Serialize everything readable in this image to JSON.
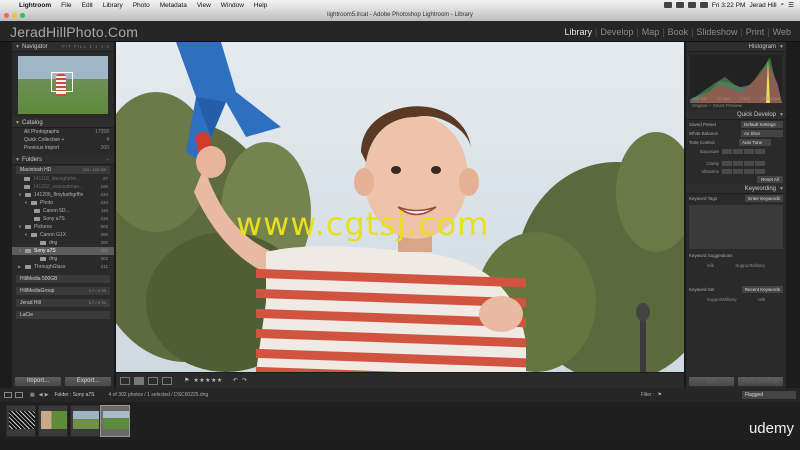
{
  "menubar": {
    "app_name": "Lightroom",
    "items": [
      "File",
      "Edit",
      "Library",
      "Photo",
      "Metadata",
      "View",
      "Window",
      "Help"
    ],
    "clock": "Fri 3:22 PM",
    "user": "Jerad Hill"
  },
  "window": {
    "title": "lightroom5.lrcat - Adobe Photoshop Lightroom - Library"
  },
  "identity_plate": "JeradHillPhoto.Com",
  "modules": [
    "Library",
    "Develop",
    "Map",
    "Book",
    "Slideshow",
    "Print",
    "Web"
  ],
  "active_module": "Library",
  "navigator": {
    "title": "Navigator",
    "zoom_options": "FIT  FILL  1:1  1:3"
  },
  "catalog": {
    "title": "Catalog",
    "rows": [
      {
        "label": "All Photographs",
        "count": "17258"
      },
      {
        "label": "Quick Collection +",
        "count": "4"
      },
      {
        "label": "Previous Import",
        "count": "200"
      }
    ]
  },
  "folders": {
    "title": "Folders",
    "volume": {
      "name": "Macintosh HD",
      "info": "215 / 465 GB"
    },
    "rows": [
      {
        "name": "141118_itavegfathe...",
        "count": "27",
        "dim": true
      },
      {
        "name": "141202_ssassatman...",
        "count": "100",
        "dim": true
      },
      {
        "name": "141206_flmybathgrffin",
        "count": "434"
      },
      {
        "name": "Photo",
        "count": "434"
      },
      {
        "name": "Canon 5D...",
        "count": "116"
      },
      {
        "name": "Sony a7S",
        "count": "318"
      },
      {
        "name": "Pictures",
        "count": "503"
      },
      {
        "name": "Canon G1X",
        "count": "200"
      },
      {
        "name": "dng",
        "count": "200"
      },
      {
        "name": "Sony a7S",
        "count": "302"
      },
      {
        "name": "dng",
        "count": "302"
      },
      {
        "name": "ThroughGlass",
        "count": "211"
      }
    ],
    "volumes": [
      {
        "name": "HillMedia 500GB",
        "info": ""
      },
      {
        "name": "HillMediaGroup",
        "info": "0.7 / 3 TB"
      },
      {
        "name": "Jerad Hill",
        "info": "0.7 / 3 TB"
      },
      {
        "name": "LaCie",
        "info": ""
      }
    ]
  },
  "left_buttons": {
    "import": "Import...",
    "export": "Export..."
  },
  "histogram": {
    "title": "Histogram",
    "iso": "ISO 100",
    "focal": "55 mm",
    "aperture": "f / 8.0",
    "shutter": "1/1250 sec",
    "preview": "Original + Smart Preview"
  },
  "quick_develop": {
    "title": "Quick Develop",
    "saved_preset": {
      "label": "Saved Preset",
      "value": "Default Settings"
    },
    "white_balance": {
      "label": "White Balance",
      "value": "As Shot"
    },
    "tone_control": {
      "label": "Tone Control",
      "value": "Auto Tone"
    },
    "sliders": [
      "Exposure",
      "Clarity",
      "Vibrance"
    ],
    "reset": "Reset All"
  },
  "keywording": {
    "title": "Keywording",
    "tags_label": "Keyword Tags",
    "tags_value": "Enter Keywords",
    "suggestions_label": "Keyword Suggestions",
    "suggestions": [
      "relk",
      "SupportMilitary"
    ],
    "set_label": "Keyword Set",
    "set_value": "Recent Keywords",
    "set_items": [
      "SupportMilitary",
      "relk"
    ]
  },
  "right_buttons": {
    "sync": "Sync",
    "sync_settings": "Sync Settings"
  },
  "toolbar": {
    "stars": "★★★★★"
  },
  "filmstrip": {
    "path": "Folder : Sony a7S",
    "info": "4 of 302 photos / 1 selected / DSC00225.dng",
    "filter_label": "Filter :",
    "filter_value": "Flagged",
    "thumbs": 4
  },
  "overlays": {
    "watermark": "www.cgtsj.com",
    "udemy": "udemy"
  },
  "colors": {
    "accent_text": "#e8e8e8",
    "panel_bg": "#2a2a2a",
    "watermark": "#e8e01a"
  }
}
